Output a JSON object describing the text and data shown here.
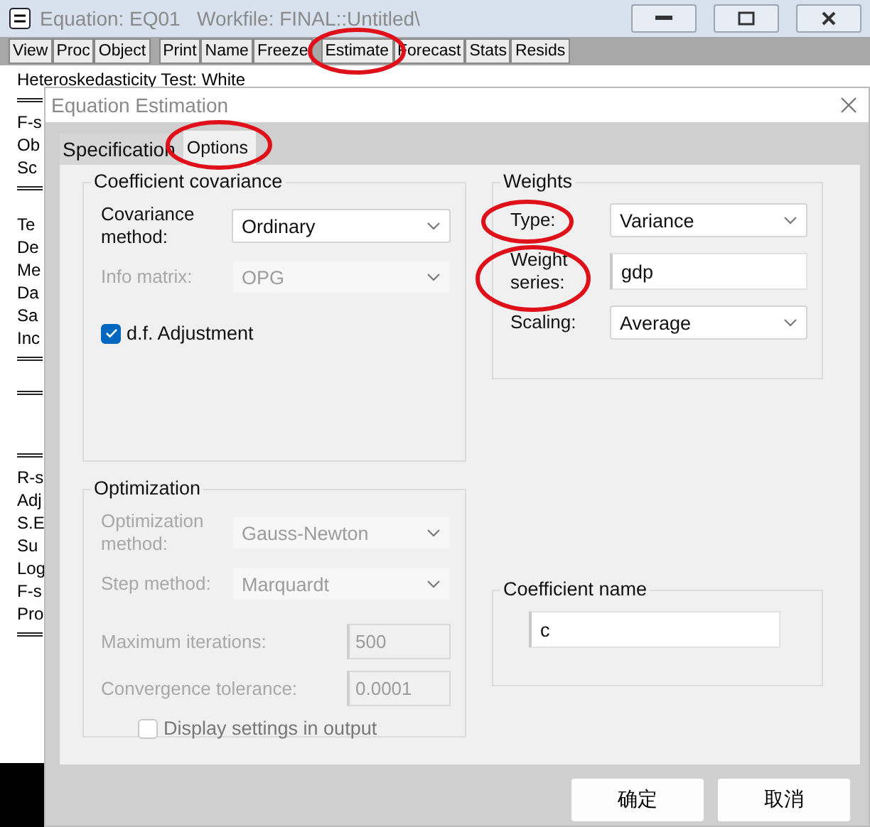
{
  "window": {
    "title": "Equation: EQ01   Workfile: FINAL::Untitled\\",
    "toolbar": [
      {
        "kind": "button",
        "label": "View"
      },
      {
        "kind": "button",
        "label": "Proc"
      },
      {
        "kind": "button",
        "label": "Object"
      },
      {
        "kind": "separator"
      },
      {
        "kind": "button",
        "label": "Print"
      },
      {
        "kind": "button",
        "label": "Name"
      },
      {
        "kind": "button",
        "label": "Freeze"
      },
      {
        "kind": "separator"
      },
      {
        "kind": "button",
        "label": "Estimate"
      },
      {
        "kind": "button",
        "label": "Forecast"
      },
      {
        "kind": "button",
        "label": "Stats"
      },
      {
        "kind": "button",
        "label": "Resids"
      }
    ],
    "output_lines": [
      {
        "kind": "heading",
        "text": "Heteroskedasticity Test: White"
      },
      {
        "kind": "rule"
      },
      {
        "kind": "text",
        "text": "F-s"
      },
      {
        "kind": "text",
        "text": "Ob"
      },
      {
        "kind": "text",
        "text": "Sc"
      },
      {
        "kind": "rule"
      },
      {
        "kind": "gap"
      },
      {
        "kind": "text",
        "text": "Te"
      },
      {
        "kind": "text",
        "text": "De"
      },
      {
        "kind": "text",
        "text": "Me"
      },
      {
        "kind": "text",
        "text": "Da"
      },
      {
        "kind": "text",
        "text": "Sa"
      },
      {
        "kind": "text",
        "text": "Inc"
      },
      {
        "kind": "rule"
      },
      {
        "kind": "gap"
      },
      {
        "kind": "rule"
      },
      {
        "kind": "gap"
      },
      {
        "kind": "gap"
      },
      {
        "kind": "gap"
      },
      {
        "kind": "rule"
      },
      {
        "kind": "text",
        "text": "R-s"
      },
      {
        "kind": "text",
        "text": "Adj"
      },
      {
        "kind": "text",
        "text": "S.E"
      },
      {
        "kind": "text",
        "text": "Su"
      },
      {
        "kind": "text",
        "text": "Log"
      },
      {
        "kind": "text",
        "text": "F-s"
      },
      {
        "kind": "text",
        "text": "Pro"
      },
      {
        "kind": "rule"
      }
    ]
  },
  "dialog": {
    "title": "Equation Estimation",
    "tabs": [
      {
        "label": "Specification",
        "selected": false
      },
      {
        "label": "Options",
        "selected": true
      }
    ],
    "coefficient_covariance": {
      "title": "Coefficient covariance",
      "covariance_method": {
        "label": "Covariance method:",
        "value": "Ordinary",
        "disabled": false
      },
      "info_matrix": {
        "label": "Info matrix:",
        "value": "OPG",
        "disabled": true
      },
      "df_adjustment": {
        "label": "d.f. Adjustment",
        "checked": true,
        "disabled": false
      }
    },
    "optimization": {
      "title": "Optimization",
      "method": {
        "label": "Optimization method:",
        "value": "Gauss-Newton",
        "disabled": true
      },
      "step_method": {
        "label": "Step method:",
        "value": "Marquardt",
        "disabled": true
      },
      "max_iterations": {
        "label": "Maximum iterations:",
        "value": "500",
        "disabled": true
      },
      "convergence_tolerance": {
        "label": "Convergence tolerance:",
        "value": "0.0001",
        "disabled": true
      },
      "display_settings": {
        "label": "Display settings in output",
        "checked": false,
        "disabled": true
      }
    },
    "weights": {
      "title": "Weights",
      "type": {
        "label": "Type:",
        "value": "Variance",
        "disabled": false
      },
      "weight_series": {
        "label": "Weight series:",
        "value": "gdp"
      },
      "scaling": {
        "label": "Scaling:",
        "value": "Average",
        "disabled": false
      }
    },
    "coefficient_name": {
      "title": "Coefficient name",
      "value": "c"
    },
    "buttons": [
      "确定",
      "取消"
    ]
  }
}
